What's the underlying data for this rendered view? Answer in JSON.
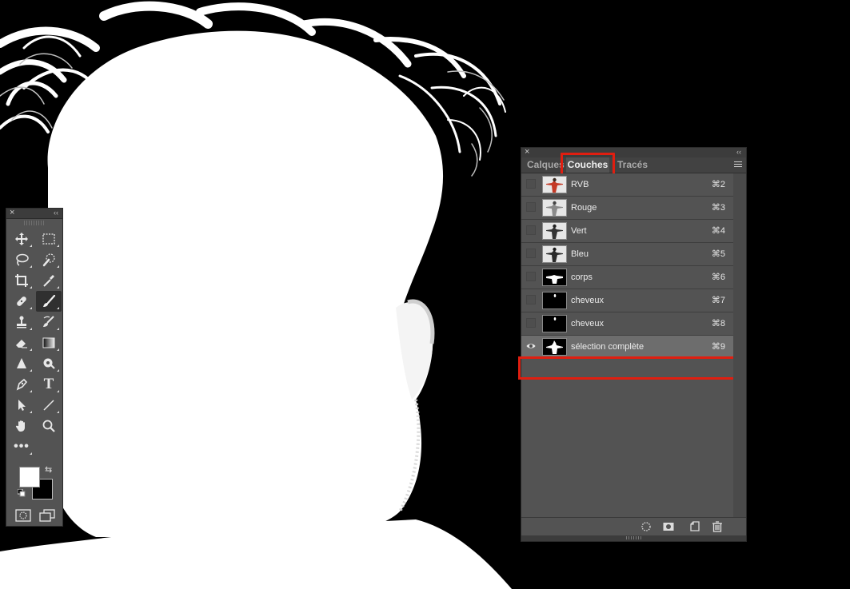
{
  "colors": {
    "panel_bg": "#535353",
    "panel_header": "#3c3c3c",
    "highlight_red": "#e01e10",
    "selected_row": "#6d6d6d"
  },
  "tools_panel": {
    "close_glyph": "×",
    "collapse_glyph": "‹‹",
    "more_label": "•••",
    "tools": [
      {
        "name": "move-tool",
        "icon": "move-icon"
      },
      {
        "name": "marquee-tool",
        "icon": "rectangle-marquee-icon"
      },
      {
        "name": "lasso-tool",
        "icon": "lasso-icon"
      },
      {
        "name": "quick-selection-tool",
        "icon": "quick-selection-icon"
      },
      {
        "name": "crop-tool",
        "icon": "crop-icon"
      },
      {
        "name": "eyedropper-tool",
        "icon": "eyedropper-icon"
      },
      {
        "name": "healing-brush-tool",
        "icon": "bandage-icon"
      },
      {
        "name": "brush-tool",
        "icon": "brush-icon",
        "active": true
      },
      {
        "name": "clone-stamp-tool",
        "icon": "stamp-icon"
      },
      {
        "name": "history-brush-tool",
        "icon": "history-brush-icon"
      },
      {
        "name": "eraser-tool",
        "icon": "eraser-icon"
      },
      {
        "name": "gradient-tool",
        "icon": "gradient-icon"
      },
      {
        "name": "blur-tool",
        "icon": "blur-icon"
      },
      {
        "name": "dodge-tool",
        "icon": "dodge-icon"
      },
      {
        "name": "pen-tool",
        "icon": "pen-icon"
      },
      {
        "name": "type-tool",
        "icon": "type-icon"
      },
      {
        "name": "path-selection-tool",
        "icon": "arrow-icon"
      },
      {
        "name": "line-tool",
        "icon": "line-icon"
      },
      {
        "name": "hand-tool",
        "icon": "hand-icon"
      },
      {
        "name": "zoom-tool",
        "icon": "zoom-icon"
      }
    ],
    "type_tool_glyph": "T",
    "swap_glyph": "⇆",
    "foreground_color": "#ffffff",
    "background_color": "#000000"
  },
  "channels_panel": {
    "close_glyph": "×",
    "collapse_glyph": "‹‹",
    "tabs": [
      {
        "label": "Calques"
      },
      {
        "label": "Couches"
      },
      {
        "label": "Tracés"
      }
    ],
    "active_tab": "Couches",
    "channels": [
      {
        "name": "RVB",
        "shortcut": "⌘2",
        "thumb": "color",
        "visible": false
      },
      {
        "name": "Rouge",
        "shortcut": "⌘3",
        "thumb": "gray",
        "visible": false
      },
      {
        "name": "Vert",
        "shortcut": "⌘4",
        "thumb": "gray",
        "visible": false
      },
      {
        "name": "Bleu",
        "shortcut": "⌘5",
        "thumb": "gray",
        "visible": false
      },
      {
        "name": "corps",
        "shortcut": "⌘6",
        "thumb": "mask-body",
        "visible": false
      },
      {
        "name": "cheveux",
        "shortcut": "⌘7",
        "thumb": "mask-small",
        "visible": false
      },
      {
        "name": "cheveux",
        "shortcut": "⌘8",
        "thumb": "mask-small",
        "visible": false
      },
      {
        "name": "sélection complète",
        "shortcut": "⌘9",
        "thumb": "mask-full",
        "visible": true,
        "selected": true
      }
    ],
    "footer_icons": [
      "load-selection-icon",
      "save-selection-icon",
      "new-channel-icon",
      "trash-icon"
    ]
  }
}
